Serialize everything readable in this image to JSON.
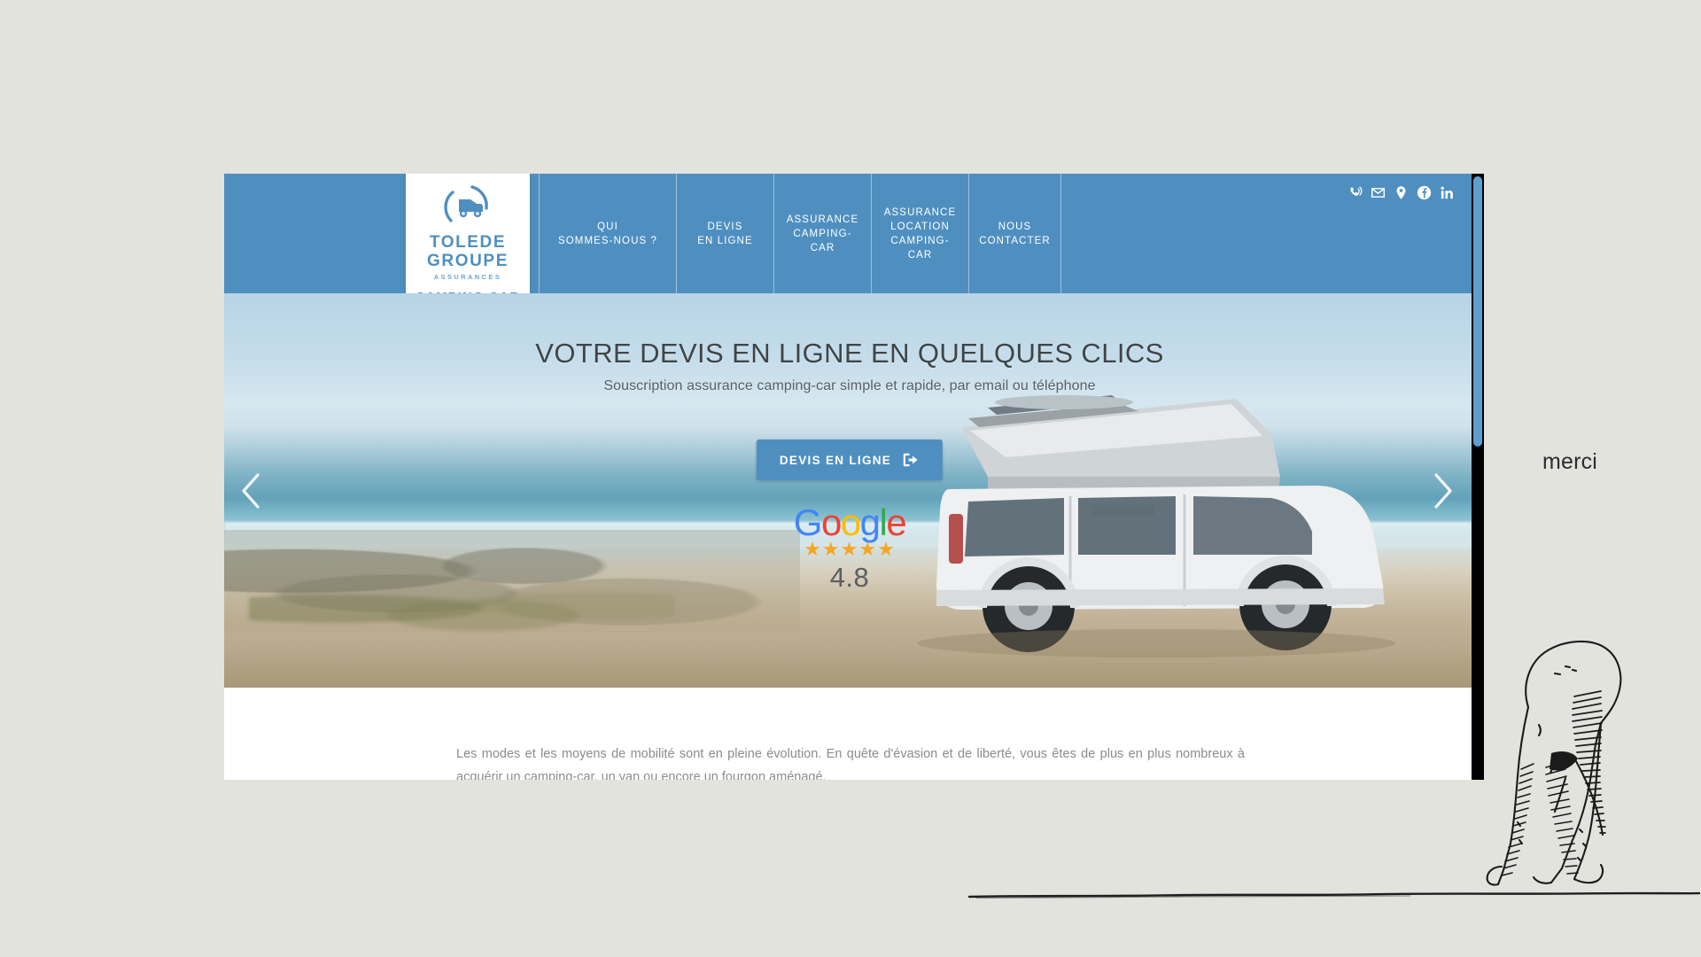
{
  "page": {
    "background_color": "#e3e3de",
    "brand_blue": "#4f8fc0"
  },
  "site": {
    "header": {
      "logo": {
        "icon": "camper-van-arc-icon",
        "line1": "TOLEDE",
        "line2": "GROUPE",
        "subtitle": "ASSURANCES",
        "product": "CAMPING CAR"
      },
      "nav": [
        {
          "label": "QUI\nSOMMES-NOUS ?",
          "name": "nav-qui-sommes-nous"
        },
        {
          "label": "DEVIS\nEN LIGNE",
          "name": "nav-devis-en-ligne"
        },
        {
          "label": "ASSURANCE\nCAMPING-CAR",
          "name": "nav-assurance-camping-car"
        },
        {
          "label": "ASSURANCE\nLOCATION\nCAMPING-CAR",
          "name": "nav-assurance-location-camping-car"
        },
        {
          "label": "NOUS\nCONTACTER",
          "name": "nav-nous-contacter"
        }
      ],
      "social": [
        {
          "icon": "phone-ringing-icon",
          "name": "social-phone"
        },
        {
          "icon": "envelope-icon",
          "name": "social-email"
        },
        {
          "icon": "location-pin-icon",
          "name": "social-location"
        },
        {
          "icon": "facebook-icon",
          "name": "social-facebook"
        },
        {
          "icon": "linkedin-icon",
          "name": "social-linkedin"
        }
      ]
    },
    "hero": {
      "title": "VOTRE DEVIS EN LIGNE EN QUELQUES CLICS",
      "subtitle": "Souscription assurance camping-car simple et rapide, par email ou téléphone",
      "cta_label": "DEVIS EN LIGNE",
      "cta_icon": "exit-arrow-icon",
      "prev_icon": "chevron-left-icon",
      "next_icon": "chevron-right-icon",
      "rating": {
        "brand": "Google",
        "brand_letters": [
          "G",
          "o",
          "o",
          "g",
          "l",
          "e"
        ],
        "brand_colors": [
          "#4285F4",
          "#EA4335",
          "#FBBC05",
          "#4285F4",
          "#34A853",
          "#EA4335"
        ],
        "stars": "★★★★★",
        "star_count": 5,
        "score": "4.8"
      }
    },
    "intro": {
      "paragraph": "Les modes et les moyens de mobilité sont en pleine évolution. En quête d'évasion et de liberté, vous êtes de plus en plus nombreux à acquérir un camping-car, un van ou encore un fourgon aménagé."
    },
    "scrollbar": {
      "name": "vertical-scrollbar",
      "thumb_color": "#5e9fd0"
    }
  },
  "annotation": {
    "word": "merci",
    "illustration": "walking-figure-engraving",
    "ground_line": "hand-drawn-ground-line"
  }
}
